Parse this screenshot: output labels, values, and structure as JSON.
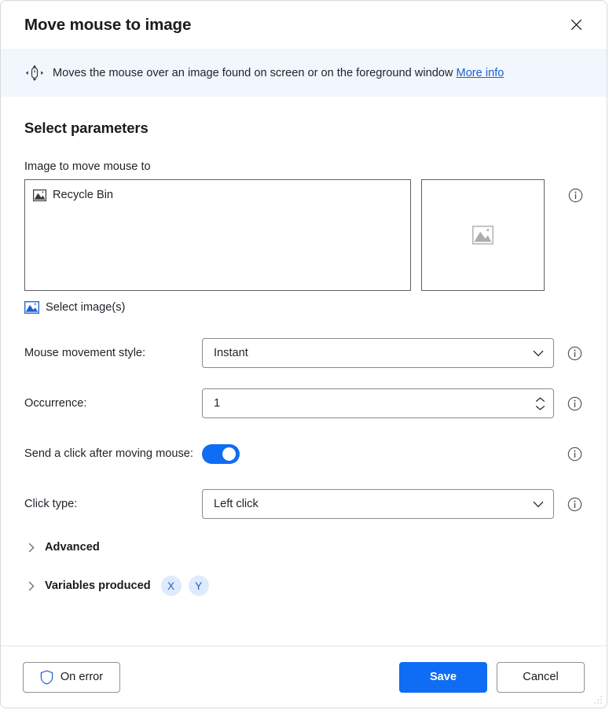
{
  "window": {
    "title": "Move mouse to image",
    "close_icon": "close-icon"
  },
  "banner": {
    "icon": "mouse-move-icon",
    "text": "Moves the mouse over an image found on screen or on the foreground window",
    "link_label": "More info"
  },
  "section": {
    "title": "Select parameters"
  },
  "image_field": {
    "label": "Image to move mouse to",
    "items": [
      {
        "icon": "image-icon",
        "label": "Recycle Bin"
      }
    ],
    "preview_placeholder_icon": "image-placeholder-icon",
    "select_images_label": "Select image(s)",
    "select_images_icon": "image-blue-icon",
    "info_icon": "info-icon"
  },
  "params": [
    {
      "label": "Mouse movement style:",
      "control": "dropdown",
      "value": "Instant",
      "info_icon": "info-icon",
      "chevron_icon": "chevron-down-icon"
    },
    {
      "label": "Occurrence:",
      "control": "number",
      "value": "1",
      "info_icon": "info-icon",
      "spinner_icon": "spinner-updown-icon"
    },
    {
      "label": "Send a click after moving mouse:",
      "control": "toggle",
      "value": "on",
      "info_icon": "info-icon"
    },
    {
      "label": "Click type:",
      "control": "dropdown",
      "value": "Left click",
      "info_icon": "info-icon",
      "chevron_icon": "chevron-down-icon"
    }
  ],
  "advanced": {
    "label": "Advanced",
    "chevron_icon": "chevron-right-icon"
  },
  "variables_produced": {
    "label": "Variables produced",
    "chevron_icon": "chevron-right-icon",
    "badges": [
      "X",
      "Y"
    ]
  },
  "footer": {
    "on_error_label": "On error",
    "on_error_icon": "shield-icon",
    "save_label": "Save",
    "cancel_label": "Cancel"
  },
  "colors": {
    "accent": "#0f6cf5",
    "link": "#1b5fce",
    "banner_bg": "#f2f6fd",
    "badge_bg": "#dfeafc",
    "border": "#8a8a8a"
  }
}
